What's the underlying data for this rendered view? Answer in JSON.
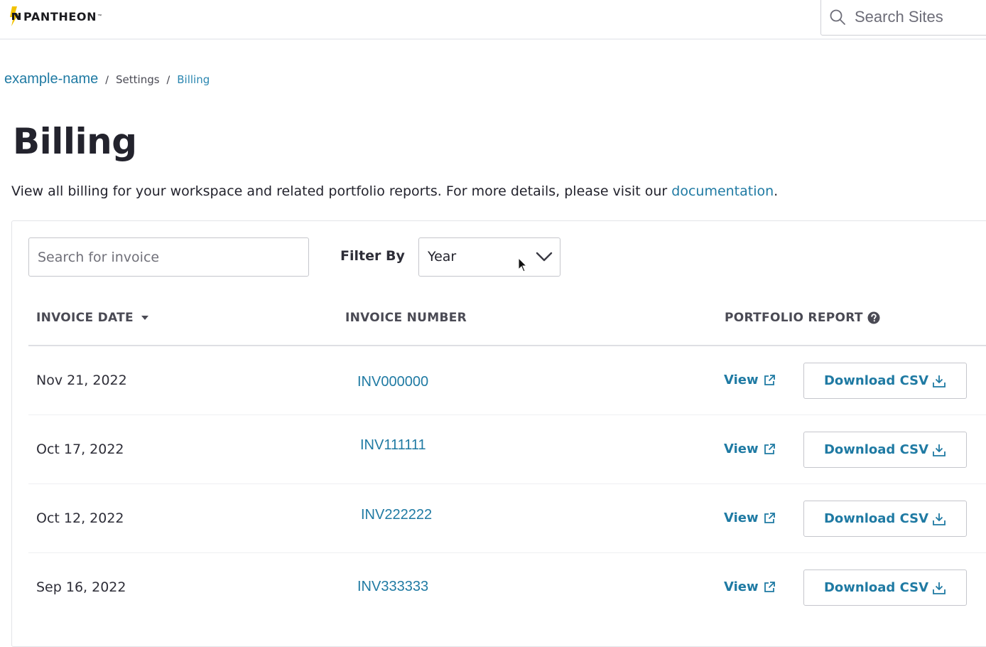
{
  "header": {
    "logo_text": "PANTHEON",
    "logo_tm": "™",
    "search_placeholder": "Search Sites"
  },
  "breadcrumb": {
    "root": "example-name",
    "separator": "/",
    "items": [
      "Settings",
      "Billing"
    ]
  },
  "page": {
    "title": "Billing",
    "description": "View all billing for your workspace and related portfolio reports. For more details, please visit our ",
    "description_link": "documentation",
    "description_end": "."
  },
  "filters": {
    "invoice_search_placeholder": "Search for invoice",
    "filter_label": "Filter By",
    "filter_value": "Year"
  },
  "table": {
    "columns": {
      "invoice_date": "INVOICE DATE",
      "invoice_number": "INVOICE NUMBER",
      "portfolio_report": "PORTFOLIO REPORT"
    },
    "view_label": "View",
    "download_label": "Download CSV",
    "rows": [
      {
        "date": "Nov 21, 2022",
        "number": "INV000000"
      },
      {
        "date": "Oct 17, 2022",
        "number": "INV111111"
      },
      {
        "date": "Oct 12, 2022",
        "number": "INV222222"
      },
      {
        "date": "Sep 16, 2022",
        "number": "INV333333"
      }
    ]
  },
  "icons": {
    "search": "search-icon",
    "chevron": "chevron-down-icon",
    "sort": "sort-down-icon",
    "help": "help-icon",
    "external": "external-link-icon",
    "download": "download-icon"
  },
  "colors": {
    "link": "#1f7aa3",
    "text": "#23232d",
    "logo_yellow": "#f2c200"
  }
}
